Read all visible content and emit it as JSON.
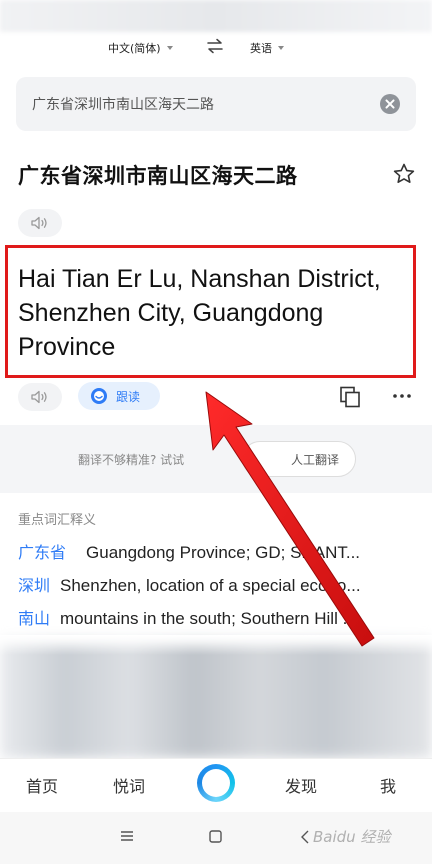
{
  "lang_bar": {
    "source_lang": "中文(简体)",
    "target_lang": "英语"
  },
  "search": {
    "value": "广东省深圳市南山区海天二路"
  },
  "result": {
    "source_text": "广东省深圳市南山区海天二路",
    "translation": "Hai Tian Er Lu, Nanshan District, Shenzhen City, Guangdong Province",
    "follow_read_label": "跟读"
  },
  "feedback": {
    "prompt": "翻译不够精准? 试试",
    "human_translate_label": "人工翻译"
  },
  "vocab": {
    "title": "重点词汇释义",
    "items": [
      {
        "word": "广东省",
        "def": "Guangdong Province; GD; SHANT..."
      },
      {
        "word": "深圳",
        "def": "Shenzhen, location of a special econo..."
      },
      {
        "word": "南山",
        "def": "mountains in the south; Southern Hill ..."
      }
    ]
  },
  "bottom_nav": {
    "home": "首页",
    "words": "悦词",
    "discover": "发现",
    "me": "我"
  },
  "watermark": "Baidu 经验",
  "colors": {
    "accent": "#2f7cf6",
    "highlight_box": "#e01a1a"
  }
}
